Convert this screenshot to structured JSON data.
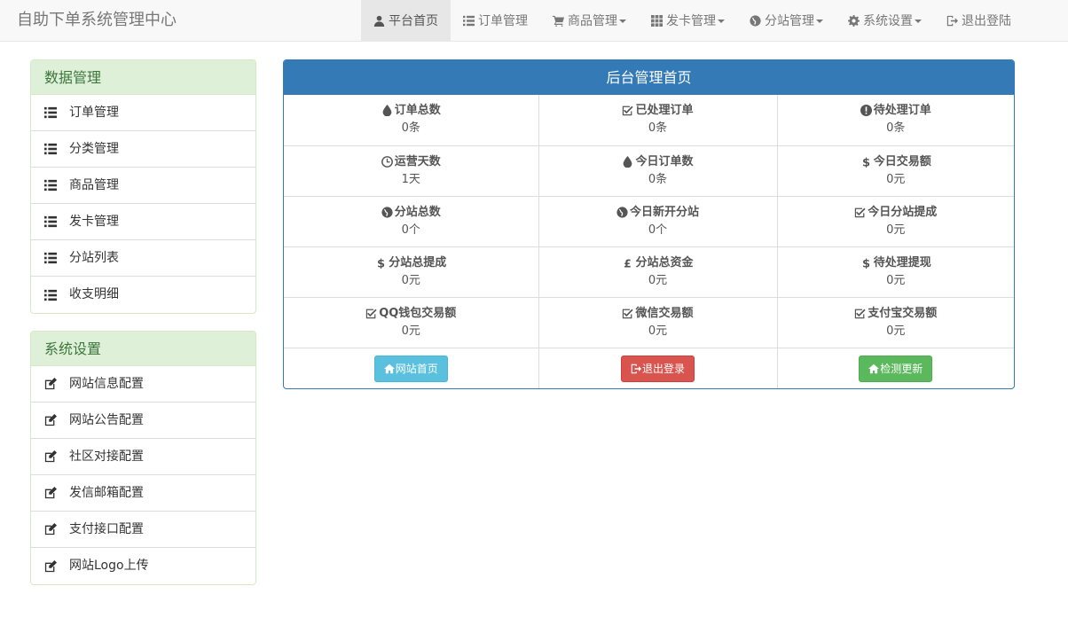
{
  "brand": "自助下单系统管理中心",
  "nav": [
    {
      "label": "平台首页",
      "icon": "user-icon",
      "dropdown": false,
      "active": true
    },
    {
      "label": "订单管理",
      "icon": "list-icon",
      "dropdown": false,
      "active": false
    },
    {
      "label": "商品管理",
      "icon": "shopping-cart-icon",
      "dropdown": true,
      "active": false
    },
    {
      "label": "发卡管理",
      "icon": "th-icon",
      "dropdown": true,
      "active": false
    },
    {
      "label": "分站管理",
      "icon": "globe-icon",
      "dropdown": true,
      "active": false
    },
    {
      "label": "系统设置",
      "icon": "cog-icon",
      "dropdown": true,
      "active": false
    },
    {
      "label": "退出登陆",
      "icon": "log-out-icon",
      "dropdown": false,
      "active": false
    }
  ],
  "sidebar": {
    "data_panel": {
      "title": "数据管理",
      "items": [
        {
          "label": "订单管理",
          "icon": "list-icon"
        },
        {
          "label": "分类管理",
          "icon": "list-icon"
        },
        {
          "label": "商品管理",
          "icon": "list-icon"
        },
        {
          "label": "发卡管理",
          "icon": "list-icon"
        },
        {
          "label": "分站列表",
          "icon": "list-icon"
        },
        {
          "label": "收支明细",
          "icon": "list-icon"
        }
      ]
    },
    "settings_panel": {
      "title": "系统设置",
      "items": [
        {
          "label": "网站信息配置",
          "icon": "edit-icon"
        },
        {
          "label": "网站公告配置",
          "icon": "edit-icon"
        },
        {
          "label": "社区对接配置",
          "icon": "edit-icon"
        },
        {
          "label": "发信邮箱配置",
          "icon": "edit-icon"
        },
        {
          "label": "支付接口配置",
          "icon": "edit-icon"
        },
        {
          "label": "网站Logo上传",
          "icon": "edit-icon"
        }
      ]
    }
  },
  "main": {
    "title": "后台管理首页",
    "stats": [
      [
        {
          "label": "订单总数",
          "value": "0条",
          "icon": "tint-icon"
        },
        {
          "label": "已处理订单",
          "value": "0条",
          "icon": "check-icon"
        },
        {
          "label": "待处理订单",
          "value": "0条",
          "icon": "exclamation-icon"
        }
      ],
      [
        {
          "label": "运营天数",
          "value": "1天",
          "icon": "clock-icon"
        },
        {
          "label": "今日订单数",
          "value": "0条",
          "icon": "tint-icon"
        },
        {
          "label": "今日交易额",
          "value": "0元",
          "icon": "dollar-icon"
        }
      ],
      [
        {
          "label": "分站总数",
          "value": "0个",
          "icon": "globe-icon"
        },
        {
          "label": "今日新开分站",
          "value": "0个",
          "icon": "globe-icon"
        },
        {
          "label": "今日分站提成",
          "value": "0元",
          "icon": "check-icon"
        }
      ],
      [
        {
          "label": "分站总提成",
          "value": "0元",
          "icon": "dollar-icon"
        },
        {
          "label": "分站总资金",
          "value": "0元",
          "icon": "pound-icon"
        },
        {
          "label": "待处理提现",
          "value": "0元",
          "icon": "dollar-icon"
        }
      ],
      [
        {
          "label": "QQ钱包交易额",
          "value": "0元",
          "icon": "check-icon"
        },
        {
          "label": "微信交易额",
          "value": "0元",
          "icon": "check-icon"
        },
        {
          "label": "支付宝交易额",
          "value": "0元",
          "icon": "check-icon"
        }
      ]
    ],
    "buttons": [
      {
        "label": "网站首页",
        "icon": "home-icon",
        "color": "#5bc0de"
      },
      {
        "label": "退出登录",
        "icon": "log-out-icon",
        "color": "#d9534f"
      },
      {
        "label": "检测更新",
        "icon": "home-icon",
        "color": "#5cb85c"
      }
    ]
  }
}
